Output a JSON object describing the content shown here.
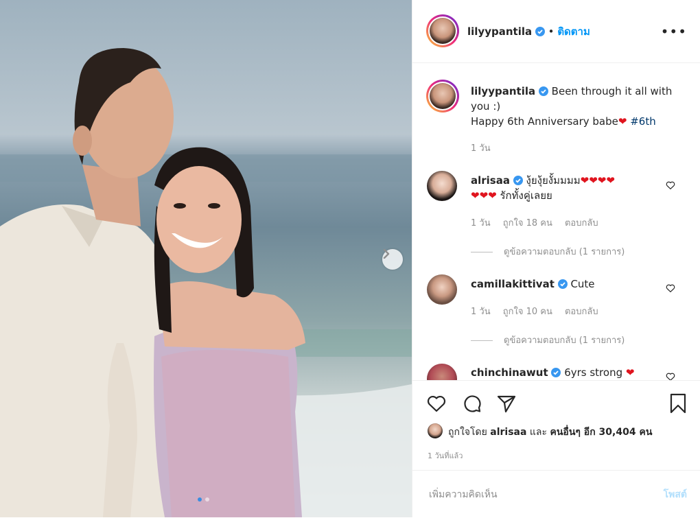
{
  "header": {
    "username": "lilyypantila",
    "separator": "•",
    "follow_label": "ติดตาม",
    "more_label": "•••"
  },
  "caption": {
    "username": "lilyypantila",
    "line1": "Been through it all with",
    "line2": "you :)",
    "line3": "Happy 6th Anniversary babe",
    "hashtag": "#6th",
    "time": "1 วัน"
  },
  "comments": [
    {
      "username": "alrisaa",
      "text_line1": "งุ้ยงุ้ยงั้มมมม",
      "hearts_line1": "❤❤❤❤",
      "hearts_line2": "❤❤❤",
      "text_line2": "รักทั้งคู่เลยย",
      "time": "1 วัน",
      "likes": "ถูกใจ 18 คน",
      "reply_label": "ตอบกลับ",
      "view_replies": "ดูข้อความตอบกลับ (1 รายการ)"
    },
    {
      "username": "camillakittivat",
      "text": "Cute",
      "time": "1 วัน",
      "likes": "ถูกใจ 10 คน",
      "reply_label": "ตอบกลับ",
      "view_replies": "ดูข้อความตอบกลับ (1 รายการ)"
    },
    {
      "username": "chinchinawut",
      "text": "6yrs strong",
      "hearts": "❤"
    }
  ],
  "likes": {
    "prefix": "ถูกใจโดย",
    "user": "alrisaa",
    "conj": "และ",
    "others": "คนอื่นๆ อีก 30,404 คน",
    "time_ago": "1 วันที่แล้ว"
  },
  "comment_box": {
    "placeholder": "เพิ่มความคิดเห็น",
    "post_label": "โพสต์"
  },
  "carousel": {
    "slides": 2,
    "active": 1
  },
  "colors": {
    "verified": "#3897f0",
    "follow": "#0095f6",
    "heart_emoji": "#e0141e",
    "hashtag": "#00376b",
    "post_disabled": "#b2dffc"
  }
}
